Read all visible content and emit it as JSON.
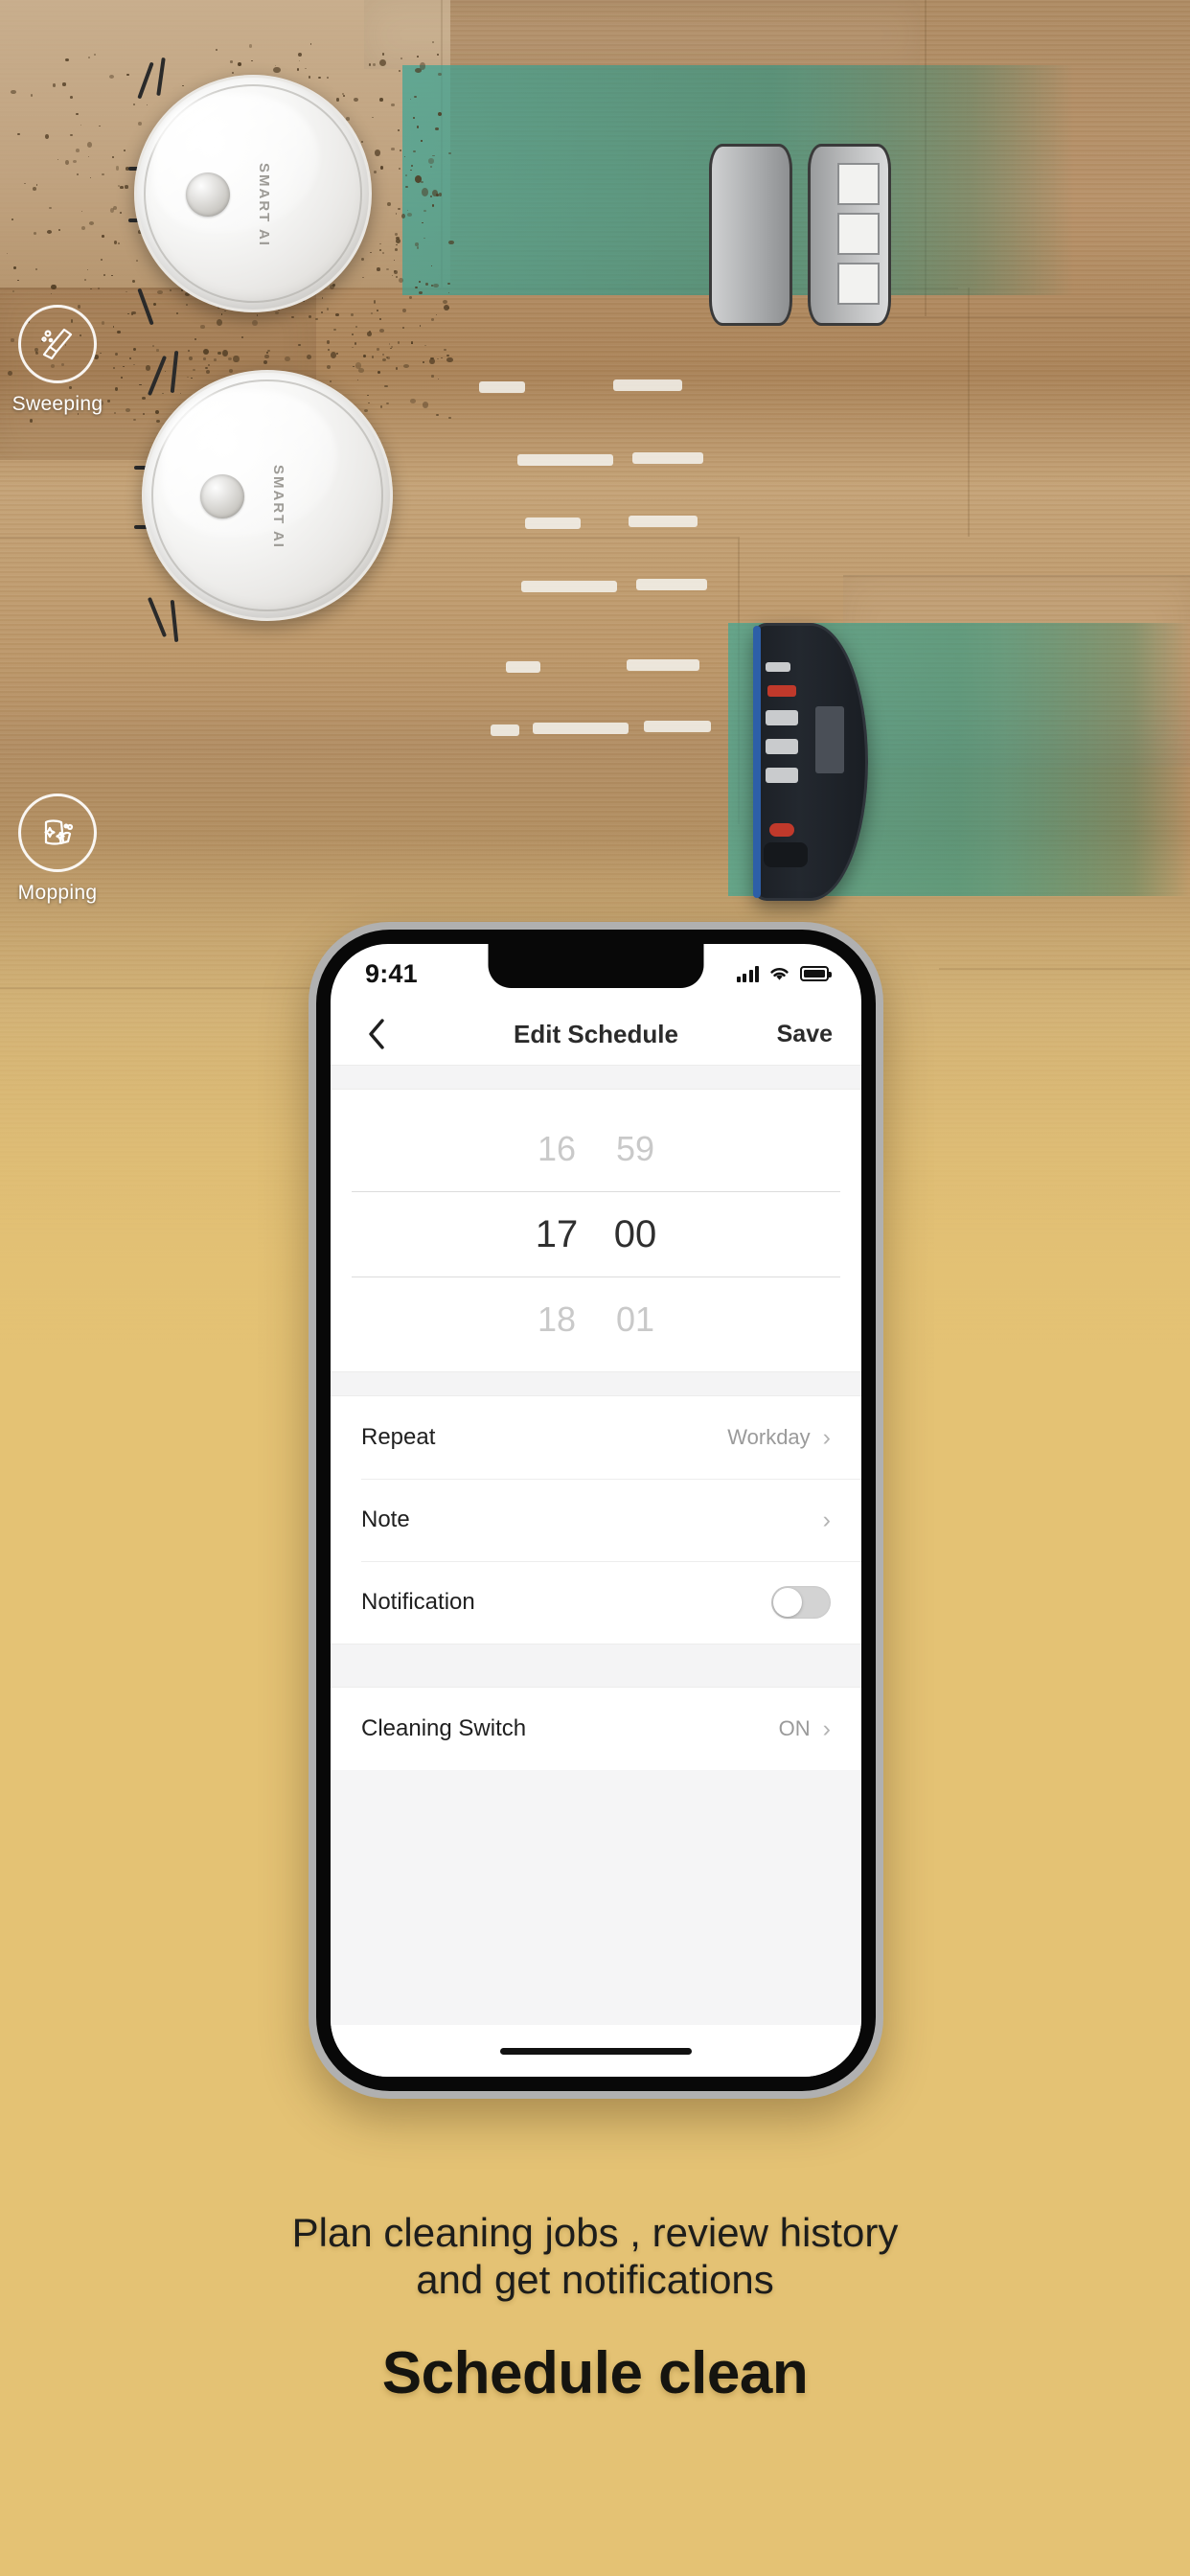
{
  "scene": {
    "background_top_color": "#ad8a62",
    "background_bottom_color": "#e4c274",
    "cleaned_path_color": "#5cb5a8",
    "badges": [
      {
        "icon": "broom-icon",
        "label": "Sweeping"
      },
      {
        "icon": "hand-wiping-cloth-icon",
        "label": "Mopping"
      }
    ],
    "robot_brand": "SMART AI"
  },
  "phone": {
    "status_bar": {
      "time": "9:41",
      "signal_icon": "cellular-signal-icon",
      "wifi_icon": "wifi-icon",
      "battery_icon": "battery-full-icon"
    },
    "nav": {
      "back_icon": "chevron-left-icon",
      "title": "Edit Schedule",
      "save_label": "Save"
    },
    "time_picker": {
      "rows": [
        {
          "hour": "16",
          "minute": "59",
          "selected": false
        },
        {
          "hour": "17",
          "minute": "00",
          "selected": true
        },
        {
          "hour": "18",
          "minute": "01",
          "selected": false
        }
      ],
      "selected_time": "17:00"
    },
    "settings": [
      {
        "label": "Repeat",
        "value": "Workday",
        "control": "chevron",
        "chevron": "›"
      },
      {
        "label": "Note",
        "value": "",
        "control": "chevron",
        "chevron": "›"
      },
      {
        "label": "Notification",
        "value": "",
        "control": "toggle",
        "toggle_on": false
      }
    ],
    "settings2": [
      {
        "label": "Cleaning Switch",
        "value": "ON",
        "control": "chevron",
        "chevron": "›"
      }
    ],
    "home_indicator": "home-indicator-bar"
  },
  "caption": {
    "subtitle_line1": "Plan cleaning jobs , review history",
    "subtitle_line2": "and get notifications",
    "title": "Schedule clean"
  }
}
